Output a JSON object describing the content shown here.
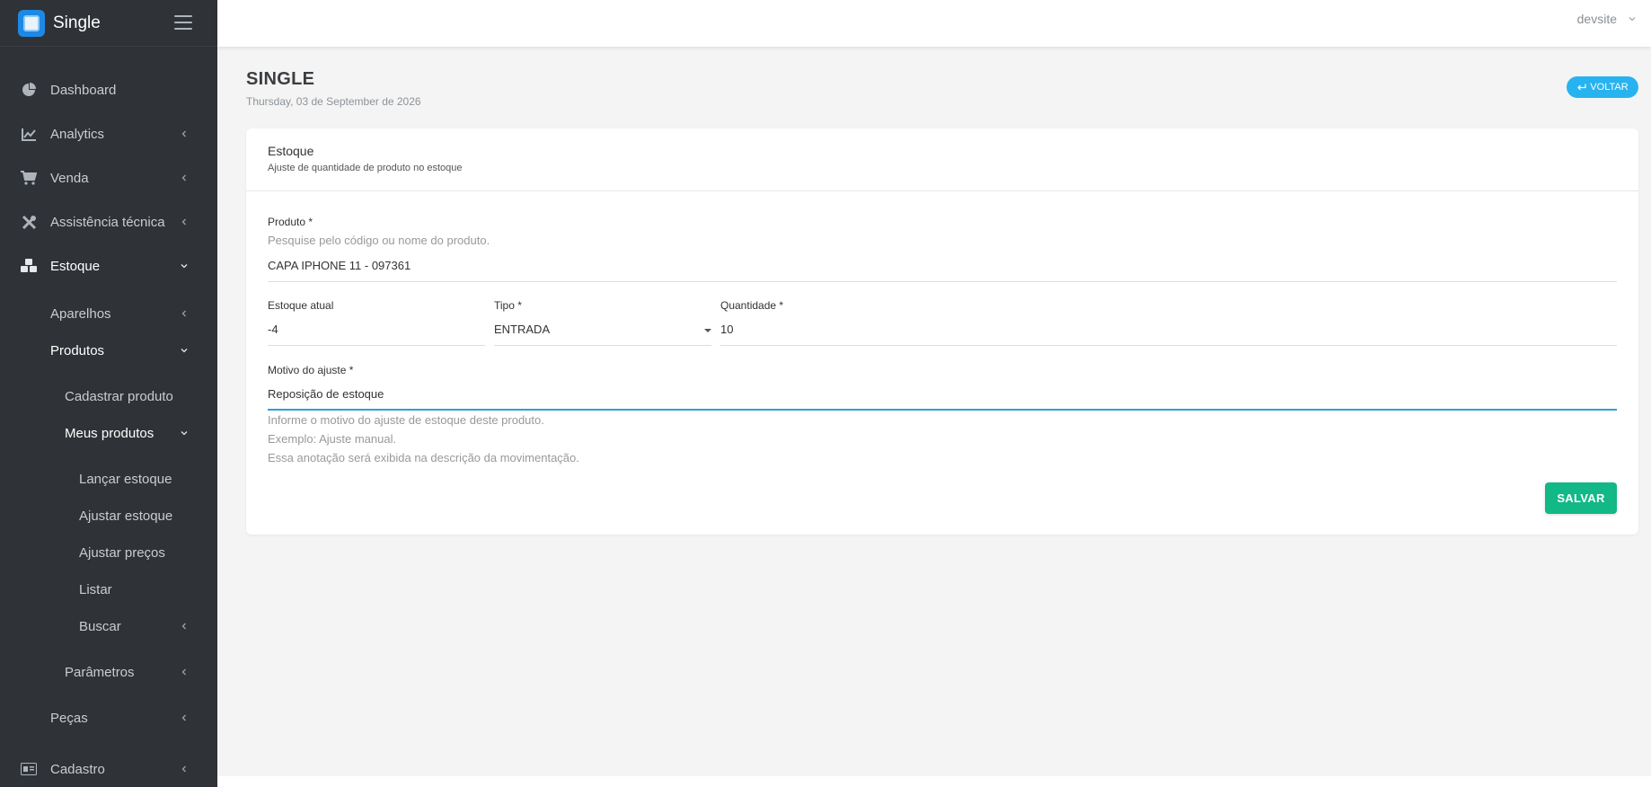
{
  "app": {
    "name": "Single"
  },
  "topbar": {
    "user": "devsite"
  },
  "sidebar": {
    "items": [
      {
        "label": "Dashboard",
        "icon": "pie-chart-icon"
      },
      {
        "label": "Analytics",
        "icon": "line-chart-icon"
      },
      {
        "label": "Venda",
        "icon": "cart-icon"
      },
      {
        "label": "Assistência técnica",
        "icon": "tools-icon"
      },
      {
        "label": "Estoque",
        "icon": "boxes-icon"
      },
      {
        "label": "Aparelhos"
      },
      {
        "label": "Produtos"
      },
      {
        "label": "Cadastrar produto"
      },
      {
        "label": "Meus produtos"
      },
      {
        "label": "Lançar estoque"
      },
      {
        "label": "Ajustar estoque"
      },
      {
        "label": "Ajustar preços"
      },
      {
        "label": "Listar"
      },
      {
        "label": "Buscar"
      },
      {
        "label": "Parâmetros"
      },
      {
        "label": "Peças"
      },
      {
        "label": "Cadastro",
        "icon": "id-card-icon"
      }
    ]
  },
  "page": {
    "title": "SINGLE",
    "date": "Thursday, 03 de September de 2026",
    "back_label": "VOLTAR"
  },
  "card": {
    "title": "Estoque",
    "subtitle": "Ajuste de quantidade de produto no estoque",
    "produto": {
      "label": "Produto *",
      "hint": "Pesquise pelo código ou nome do produto.",
      "value": "CAPA IPHONE 11 - 097361"
    },
    "estoque_atual": {
      "label": "Estoque atual",
      "value": "-4"
    },
    "tipo": {
      "label": "Tipo *",
      "value": "ENTRADA"
    },
    "quantidade": {
      "label": "Quantidade *",
      "value": "10"
    },
    "motivo": {
      "label": "Motivo do ajuste *",
      "value": "Reposição de estoque",
      "help": [
        "Informe o motivo do ajuste de estoque deste produto.",
        "Exemplo: Ajuste manual.",
        "Essa anotação será exibida na descrição da movimentação."
      ]
    },
    "save_label": "SALVAR"
  },
  "colors": {
    "sidebar_bg": "#2f3337",
    "accent_blue": "#27b3f0",
    "save_green": "#12b886",
    "focus_line": "#27a2d9"
  }
}
